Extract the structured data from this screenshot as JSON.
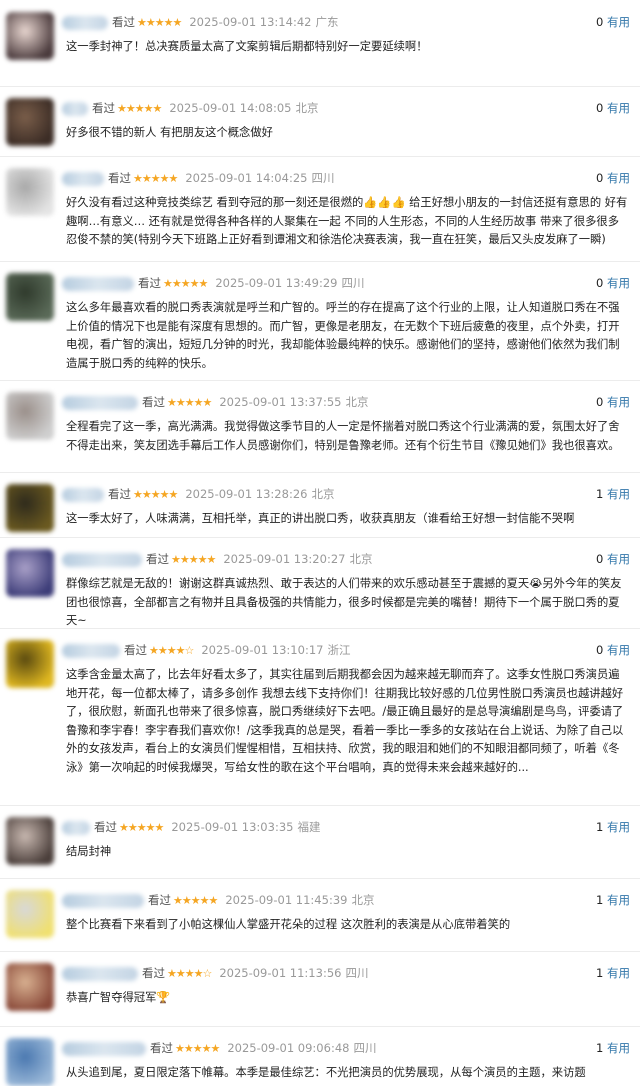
{
  "reviews": [
    {
      "watched_label": "看过",
      "stars": "★★★★★",
      "time": "2025-09-01 13:14:42",
      "location": "广东",
      "useful_count": "0",
      "useful_label": "有用",
      "content": "这一季封神了！总决赛质量太高了文案剪辑后期都特别好一定要延续啊！",
      "avatar_colors": [
        "#4a3a3c",
        "#e8d6d0"
      ]
    },
    {
      "watched_label": "看过",
      "stars": "★★★★★",
      "time": "2025-09-01 14:08:05",
      "location": "北京",
      "useful_count": "0",
      "useful_label": "有用",
      "content": "好多很不错的新人 有把朋友这个概念做好",
      "avatar_colors": [
        "#3b2c25",
        "#7a5e4a"
      ]
    },
    {
      "watched_label": "看过",
      "stars": "★★★★★",
      "time": "2025-09-01 14:04:25",
      "location": "四川",
      "useful_count": "0",
      "useful_label": "有用",
      "content": "好久没有看过这种竞技类综艺 看到夺冠的那一刻还是很燃的👍👍👍 给王好想小朋友的一封信还挺有意思的 好有趣啊…有意义… 还有就是觉得各种各样的人聚集在一起 不同的人生形态，不同的人生经历故事 带来了很多很多忍俊不禁的笑(特别今天下班路上正好看到谭湘文和徐浩伦决赛表演，我一直在狂笑，最后又头皮发麻了一瞬)",
      "avatar_colors": [
        "#e4e4e4",
        "#a8a8a8"
      ]
    },
    {
      "watched_label": "看过",
      "stars": "★★★★★",
      "time": "2025-09-01 13:49:29",
      "location": "四川",
      "useful_count": "0",
      "useful_label": "有用",
      "content": "这么多年最喜欢看的脱口秀表演就是呼兰和广智的。呼兰的存在提高了这个行业的上限，让人知道脱口秀在不强上价值的情况下也是能有深度有思想的。而广智，更像是老朋友，在无数个下班后疲惫的夜里，点个外卖，打开电视，看广智的演出，短短几分钟的时光，我却能体验最纯粹的快乐。感谢他们的坚持，感谢他们依然为我们制造属于脱口秀的纯粹的快乐。",
      "avatar_colors": [
        "#5a6a58",
        "#2f3a2c"
      ]
    },
    {
      "watched_label": "看过",
      "stars": "★★★★★",
      "time": "2025-09-01 13:37:55",
      "location": "北京",
      "useful_count": "0",
      "useful_label": "有用",
      "content": "全程看完了这一季，高光满满。我觉得做这季节目的人一定是怀揣着对脱口秀这个行业满满的爱，氛围太好了舍不得走出来，笑友团选手幕后工作人员感谢你们，特别是鲁豫老师。还有个衍生节目《豫见她们》我也很喜欢。",
      "avatar_colors": [
        "#cfcfcf",
        "#9a8f8a"
      ]
    },
    {
      "watched_label": "看过",
      "stars": "★★★★★",
      "time": "2025-09-01 13:28:26",
      "location": "北京",
      "useful_count": "1",
      "useful_label": "有用",
      "content": "这一季太好了，人味满满，互相托举，真正的讲出脱口秀，收获真朋友（谁看给王好想一封信能不哭啊",
      "avatar_colors": [
        "#6b5a20",
        "#2e2a1c"
      ]
    },
    {
      "watched_label": "看过",
      "stars": "★★★★★",
      "time": "2025-09-01 13:20:27",
      "location": "北京",
      "useful_count": "0",
      "useful_label": "有用",
      "content": "群像综艺就是无敌的！谢谢这群真诚热烈、敢于表达的人们带来的欢乐感动甚至于震撼的夏天😭另外今年的笑友团也很惊喜，全部都言之有物并且具备极强的共情能力，很多时候都是完美的嘴替！期待下一个属于脱口秀的夏天~",
      "avatar_colors": [
        "#3c3c78",
        "#a9a0c8"
      ]
    },
    {
      "watched_label": "看过",
      "stars": "★★★★☆",
      "time": "2025-09-01 13:10:17",
      "location": "浙江",
      "useful_count": "0",
      "useful_label": "有用",
      "content": "这季含金量太高了，比去年好看太多了，其实往届到后期我都会因为越来越无聊而弃了。这季女性脱口秀演员遍地开花，每一位都太棒了，请多多创作 我想去线下支持你们！往期我比较好感的几位男性脱口秀演员也越讲越好了，很欣慰，新面孔也带来了很多惊喜，脱口秀继续好下去吧。/最正确且最好的是总导演编剧是鸟鸟，评委请了鲁豫和李宇春！李宇春我们喜欢你！/这季我真的总是哭，看着一季比一季多的女孩站在台上说话、为除了自己以外的女孩发声，看台上的女演员们惺惺相惜，互相扶持、欣赏，我的眼泪和她们的不知眼泪都同频了，听着《冬泳》第一次响起的时候我爆哭，写给女性的歌在这个平台唱响，真的觉得未来会越来越好的...",
      "avatar_colors": [
        "#e0b820",
        "#5a4a10"
      ]
    },
    {
      "watched_label": "看过",
      "stars": "★★★★★",
      "time": "2025-09-01 13:03:35",
      "location": "福建",
      "useful_count": "1",
      "useful_label": "有用",
      "content": "结局封神",
      "avatar_colors": [
        "#4a3e3a",
        "#c8b8b0"
      ]
    },
    {
      "watched_label": "看过",
      "stars": "★★★★★",
      "time": "2025-09-01 11:45:39",
      "location": "北京",
      "useful_count": "1",
      "useful_label": "有用",
      "content": "整个比赛看下来看到了小帕这棵仙人掌盛开花朵的过程 这次胜利的表演是从心底带着笑的",
      "avatar_colors": [
        "#f0e070",
        "#d8d8d8"
      ]
    },
    {
      "watched_label": "看过",
      "stars": "★★★★☆",
      "time": "2025-09-01 11:13:56",
      "location": "四川",
      "useful_count": "1",
      "useful_label": "有用",
      "content": "恭喜广智夺得冠军🏆",
      "avatar_colors": [
        "#8a4a3a",
        "#d8b090"
      ]
    },
    {
      "watched_label": "看过",
      "stars": "★★★★★",
      "time": "2025-09-01 09:06:48",
      "location": "四川",
      "useful_count": "1",
      "useful_label": "有用",
      "content": "从头追到尾，夏日限定落下帷幕。本季是最佳综艺：不光把演员的优势展现，从每个演员的主题，来访题",
      "avatar_colors": [
        "#9ab8d8",
        "#4a78b0"
      ]
    }
  ]
}
